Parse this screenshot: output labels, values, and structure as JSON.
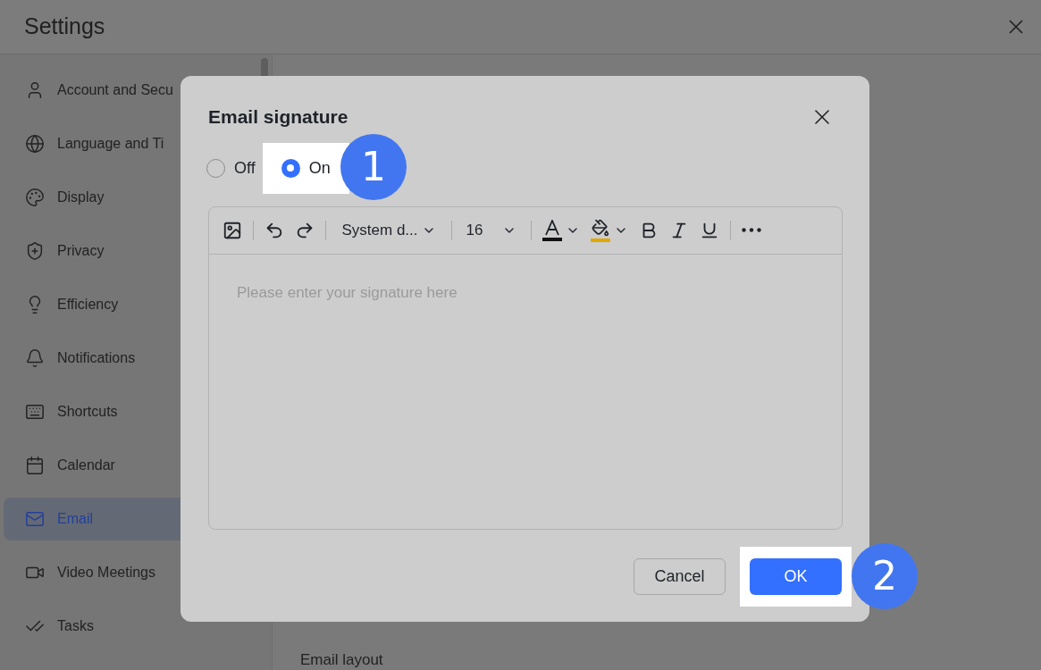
{
  "window": {
    "title": "Settings"
  },
  "sidebar": {
    "items": [
      {
        "label": "Account and Secu",
        "selected": false
      },
      {
        "label": "Language and Ti",
        "selected": false
      },
      {
        "label": "Display",
        "selected": false
      },
      {
        "label": "Privacy",
        "selected": false
      },
      {
        "label": "Efficiency",
        "selected": false
      },
      {
        "label": "Notifications",
        "selected": false
      },
      {
        "label": "Shortcuts",
        "selected": false
      },
      {
        "label": "Calendar",
        "selected": false
      },
      {
        "label": "Email",
        "selected": true
      },
      {
        "label": "Video Meetings",
        "selected": false
      },
      {
        "label": "Tasks",
        "selected": false
      }
    ]
  },
  "content": {
    "section_title": "Email layout"
  },
  "dialog": {
    "title": "Email signature",
    "radios": [
      {
        "label": "Off",
        "selected": false,
        "highlighted": false
      },
      {
        "label": "On",
        "selected": true,
        "highlighted": true
      }
    ],
    "toolbar": [
      {
        "kind": "image"
      },
      {
        "kind": "divider"
      },
      {
        "kind": "undo"
      },
      {
        "kind": "redo"
      },
      {
        "kind": "divider"
      },
      {
        "kind": "select",
        "value": "System d..."
      },
      {
        "kind": "divider"
      },
      {
        "kind": "size",
        "value": "16"
      },
      {
        "kind": "divider"
      },
      {
        "kind": "text-color",
        "color": "#111111"
      },
      {
        "kind": "highlight-color",
        "color": "#e0a800"
      },
      {
        "kind": "bold"
      },
      {
        "kind": "italic"
      },
      {
        "kind": "underline"
      },
      {
        "kind": "divider"
      },
      {
        "kind": "more"
      }
    ],
    "editor": {
      "placeholder": "Please enter your signature here"
    },
    "buttons": [
      {
        "label": "Cancel",
        "kind": "secondary",
        "highlighted": false
      },
      {
        "label": "OK",
        "kind": "primary",
        "highlighted": true
      }
    ]
  },
  "callouts": [
    "1",
    "2"
  ]
}
